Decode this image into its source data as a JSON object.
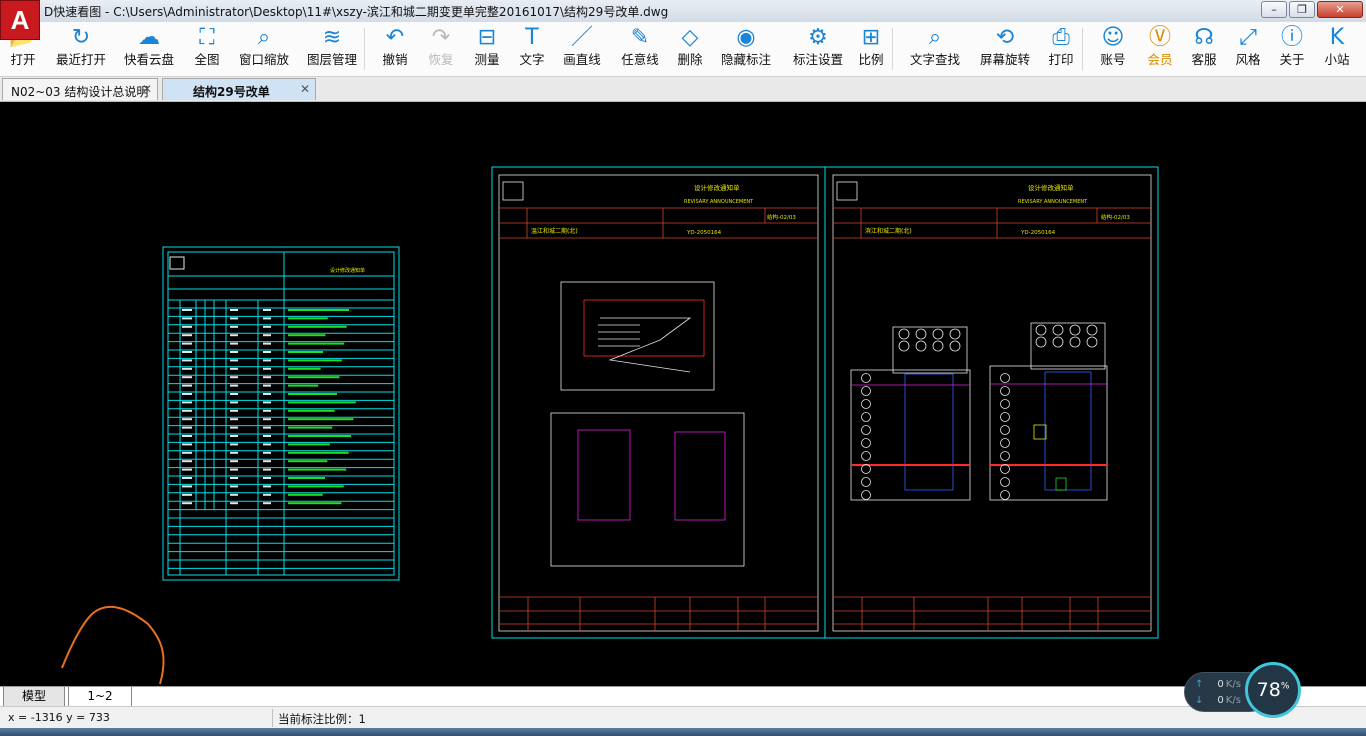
{
  "window": {
    "title": "D快速看图 - C:\\Users\\Administrator\\Desktop\\11#\\xszy-滨江和城二期变更单完整20161017\\结构29号改单.dwg",
    "logo_letter": "A",
    "minimize": "–",
    "maximize": "❐",
    "close": "✕"
  },
  "toolbar": [
    {
      "icon": "folder-open-icon",
      "glyph": "📂",
      "label": "打开",
      "enabled": true
    },
    {
      "icon": "recent-open-icon",
      "glyph": "↻",
      "label": "最近打开",
      "enabled": true
    },
    {
      "icon": "cloud-icon",
      "glyph": "☁",
      "label": "快看云盘",
      "enabled": true
    },
    {
      "icon": "fullscreen-icon",
      "glyph": "⛶",
      "label": "全图",
      "enabled": true
    },
    {
      "icon": "window-zoom-icon",
      "glyph": "⌕",
      "label": "窗口缩放",
      "enabled": true
    },
    {
      "icon": "layers-icon",
      "glyph": "≋",
      "label": "图层管理",
      "enabled": true
    },
    {
      "icon": "undo-icon",
      "glyph": "↶",
      "label": "撤销",
      "enabled": true
    },
    {
      "icon": "redo-icon",
      "glyph": "↷",
      "label": "恢复",
      "enabled": false
    },
    {
      "icon": "measure-icon",
      "glyph": "⊟",
      "label": "测量",
      "enabled": true
    },
    {
      "icon": "text-icon",
      "glyph": "T",
      "label": "文字",
      "enabled": true
    },
    {
      "icon": "line-icon",
      "glyph": "／",
      "label": "画直线",
      "enabled": true
    },
    {
      "icon": "freehand-icon",
      "glyph": "✎",
      "label": "任意线",
      "enabled": true
    },
    {
      "icon": "eraser-icon",
      "glyph": "◇",
      "label": "删除",
      "enabled": true
    },
    {
      "icon": "eye-hide-icon",
      "glyph": "◉",
      "label": "隐藏标注",
      "enabled": true
    },
    {
      "icon": "annotation-settings-icon",
      "glyph": "⚙",
      "label": "标注设置",
      "enabled": true
    },
    {
      "icon": "scale-icon",
      "glyph": "⊞",
      "label": "比例",
      "enabled": true
    },
    {
      "icon": "text-search-icon",
      "glyph": "⌕",
      "label": "文字查找",
      "enabled": true
    },
    {
      "icon": "rotate-screen-icon",
      "glyph": "⟲",
      "label": "屏幕旋转",
      "enabled": true
    },
    {
      "icon": "print-icon",
      "glyph": "⎙",
      "label": "打印",
      "enabled": true
    },
    {
      "icon": "account-icon",
      "glyph": "☺",
      "label": "账号",
      "enabled": true
    },
    {
      "icon": "vip-icon",
      "glyph": "Ⓥ",
      "label": "会员",
      "enabled": true,
      "vip": true
    },
    {
      "icon": "headset-icon",
      "glyph": "☊",
      "label": "客服",
      "enabled": true
    },
    {
      "icon": "style-icon",
      "glyph": "⤢",
      "label": "风格",
      "enabled": true
    },
    {
      "icon": "info-icon",
      "glyph": "ⓘ",
      "label": "关于",
      "enabled": true
    },
    {
      "icon": "station-icon",
      "glyph": "K",
      "label": "小站",
      "enabled": true
    }
  ],
  "tabs": [
    {
      "label": "N02~03 结构设计总说明",
      "close": "✕",
      "active": false
    },
    {
      "label": "结构29号改单",
      "close": "✕",
      "active": true
    }
  ],
  "layout_tabs": {
    "model": "模型",
    "layout": "1~2"
  },
  "status": {
    "coords": "x = -1316 y = 733",
    "scale": "当前标注比例：1"
  },
  "netspeed": {
    "up_arrow": "↑",
    "down_arrow": "↓",
    "up_value": "0",
    "down_value": "0",
    "unit": "K/s",
    "percent": "78",
    "percent_suffix": "%"
  },
  "drawing": {
    "sheet_header": "设计修改通知单",
    "sheet_header_en": "REVISARY ANNOUNCEMENT",
    "sheet1_code": "结构-02/03",
    "sheet2_code": "结构-02/03",
    "sheet1_project": "温江和城二期(北)",
    "sheet2_project": "滨江和城二期(北)",
    "sheet1_number": "YD-2050164",
    "sheet2_number": "YD-2050164",
    "colors": {
      "frame": "#00e0e8",
      "grid": "#d4452a",
      "line": "#e6e6e6",
      "accent": "#ff2a2a",
      "magenta": "#e020e0",
      "yellow": "#e6e600",
      "green": "#22dd22",
      "blue": "#3060ff"
    }
  }
}
